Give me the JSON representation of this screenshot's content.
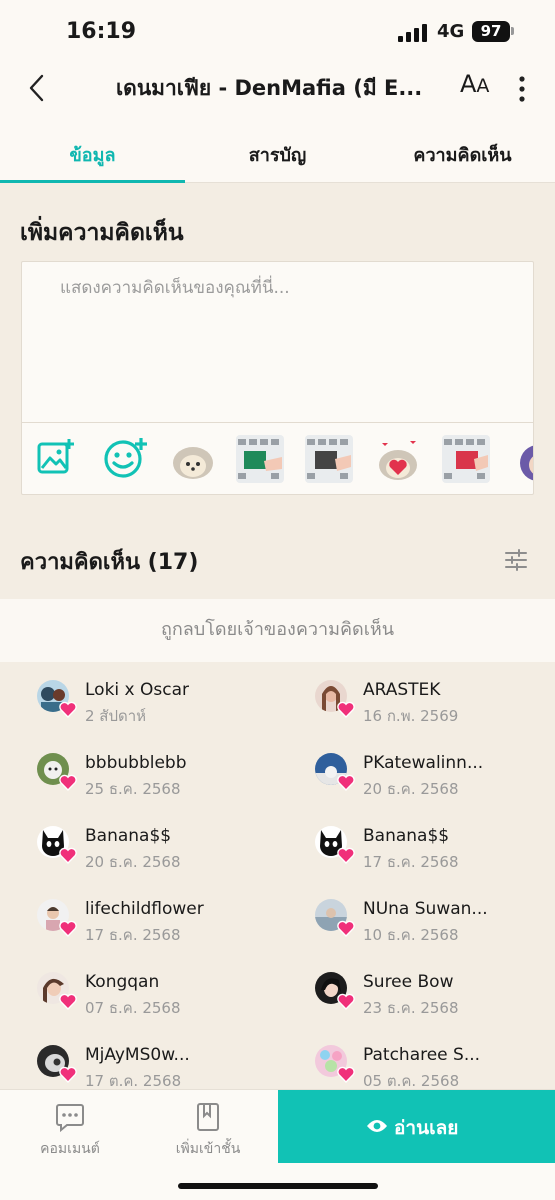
{
  "status_bar": {
    "time": "16:19",
    "network": "4G",
    "battery": "97"
  },
  "header": {
    "title": "เดนมาเฟีย - DenMafia (มี E...",
    "font_size_label_big": "A",
    "font_size_label_small": "A"
  },
  "tabs": [
    {
      "label": "ข้อมูล",
      "active": true
    },
    {
      "label": "สารบัญ",
      "active": false
    },
    {
      "label": "ความคิดเห็น",
      "active": false
    }
  ],
  "add_comment": {
    "title": "เพิ่มความคิดเห็น",
    "placeholder": "แสดงความคิดเห็นของคุณที่นี่...",
    "stickers": [
      "hedgehog-sticker",
      "keyboard-sticker",
      "keyboard-sticker",
      "hedgehog-heart-sticker",
      "keyboard-sticker",
      "character-sticker"
    ]
  },
  "comments": {
    "title": "ความคิดเห็น (17)",
    "deleted_notice": "ถูกลบโดยเจ้าของความคิดเห็น",
    "reactors": [
      {
        "name": "Loki x Oscar",
        "date": "2 สัปดาห์"
      },
      {
        "name": "ARASTEK",
        "date": "16 ก.พ. 2569"
      },
      {
        "name": "bbbubblebb",
        "date": "25 ธ.ค. 2568"
      },
      {
        "name": "PKatewalinn...",
        "date": "20 ธ.ค. 2568"
      },
      {
        "name": "Banana$$",
        "date": "20 ธ.ค. 2568"
      },
      {
        "name": "Banana$$",
        "date": "17 ธ.ค. 2568"
      },
      {
        "name": "lifechildflower",
        "date": "17 ธ.ค. 2568"
      },
      {
        "name": "NUna Suwan...",
        "date": "10 ธ.ค. 2568"
      },
      {
        "name": "Kongqan",
        "date": "07 ธ.ค. 2568"
      },
      {
        "name": "Suree Bow",
        "date": "23 ธ.ค. 2568"
      },
      {
        "name": "MjAyMS0w...",
        "date": "17 ต.ค. 2568"
      },
      {
        "name": "Patcharee S...",
        "date": "05 ต.ค. 2568"
      }
    ]
  },
  "bottom_bar": {
    "comment_label": "คอมเมนต์",
    "add_shelf_label": "เพิ่มเข้าชั้น",
    "read_now_label": "อ่านเลย"
  },
  "colors": {
    "accent": "#11c2b5",
    "heart": "#f0307a",
    "background": "#f3ede3"
  }
}
